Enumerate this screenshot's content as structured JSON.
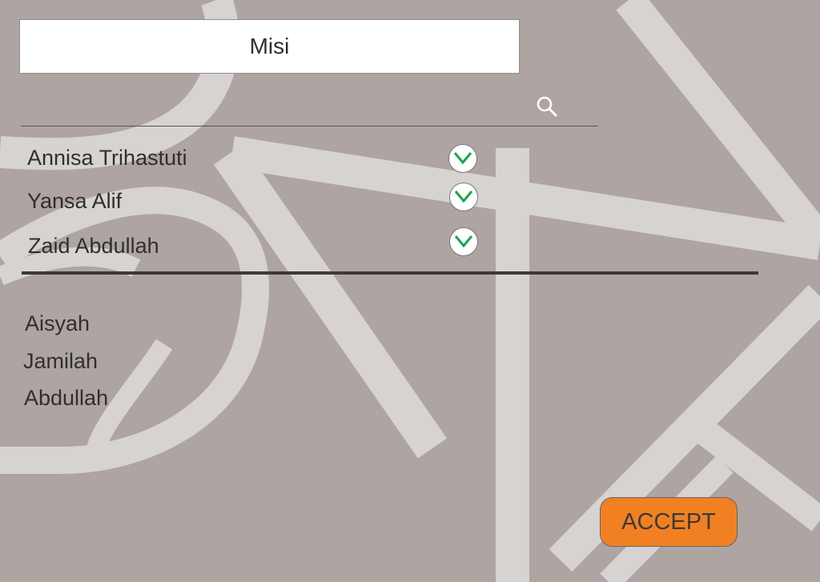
{
  "app": {
    "title": "Misi"
  },
  "search": {
    "icon": "search-icon"
  },
  "selected_list": {
    "items": [
      {
        "name": "Annisa Trihastuti",
        "checked": true,
        "icon": "check-icon"
      },
      {
        "name": "Yansa Alif",
        "checked": true,
        "icon": "check-icon"
      },
      {
        "name": "Zaid Abdullah",
        "checked": true,
        "icon": "check-icon"
      }
    ]
  },
  "available_list": {
    "items": [
      {
        "name": "Aisyah"
      },
      {
        "name": "Jamilah"
      },
      {
        "name": "Abdullah"
      }
    ]
  },
  "actions": {
    "accept_label": "ACCEPT"
  },
  "colors": {
    "background": "#aea5a3",
    "accent": "#f08022",
    "check": "#17a84a"
  }
}
